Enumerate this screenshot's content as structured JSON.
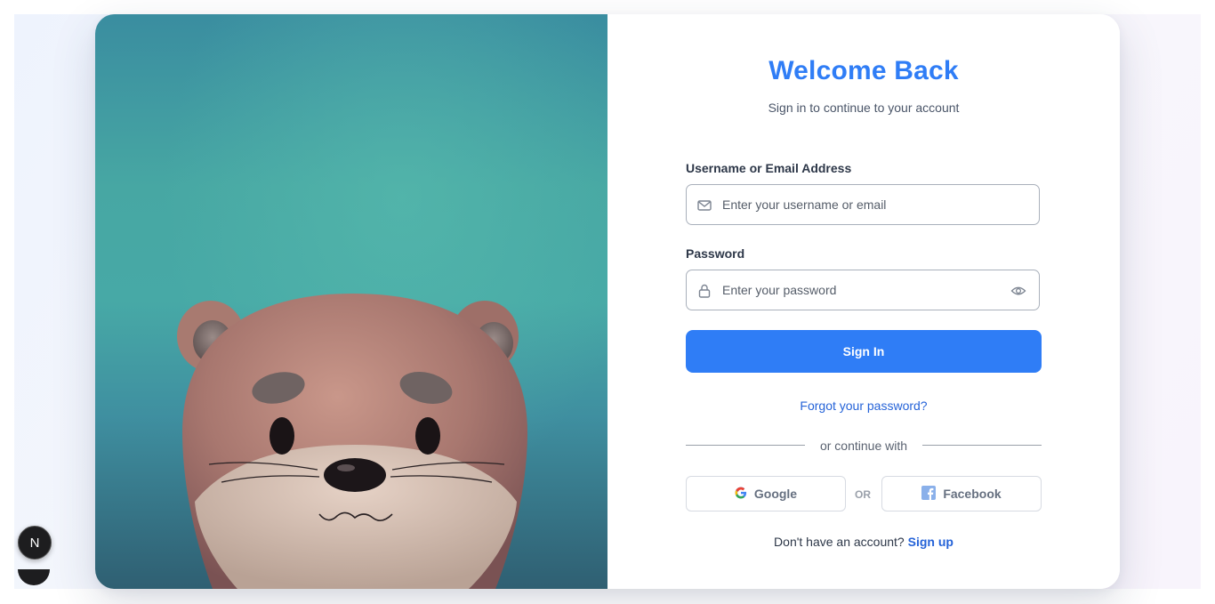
{
  "login": {
    "title": "Welcome Back",
    "subtitle": "Sign in to continue to your account",
    "username_label": "Username or Email Address",
    "username_placeholder": "Enter your username or email",
    "password_label": "Password",
    "password_placeholder": "Enter your password",
    "signin_label": "Sign In",
    "forgot_label": "Forgot your password?",
    "divider_text": "or continue with",
    "google_label": "Google",
    "or_label": "OR",
    "facebook_label": "Facebook",
    "signup_prompt": "Don't have an account?",
    "signup_label": "Sign up"
  },
  "badge": {
    "letter": "N"
  },
  "icons": {
    "email": "mail-icon",
    "password": "lock-icon",
    "toggle_visibility": "eye-icon",
    "google": "google-icon",
    "facebook": "facebook-icon"
  },
  "colors": {
    "accent": "#2f7df6",
    "link": "#2563d8"
  }
}
